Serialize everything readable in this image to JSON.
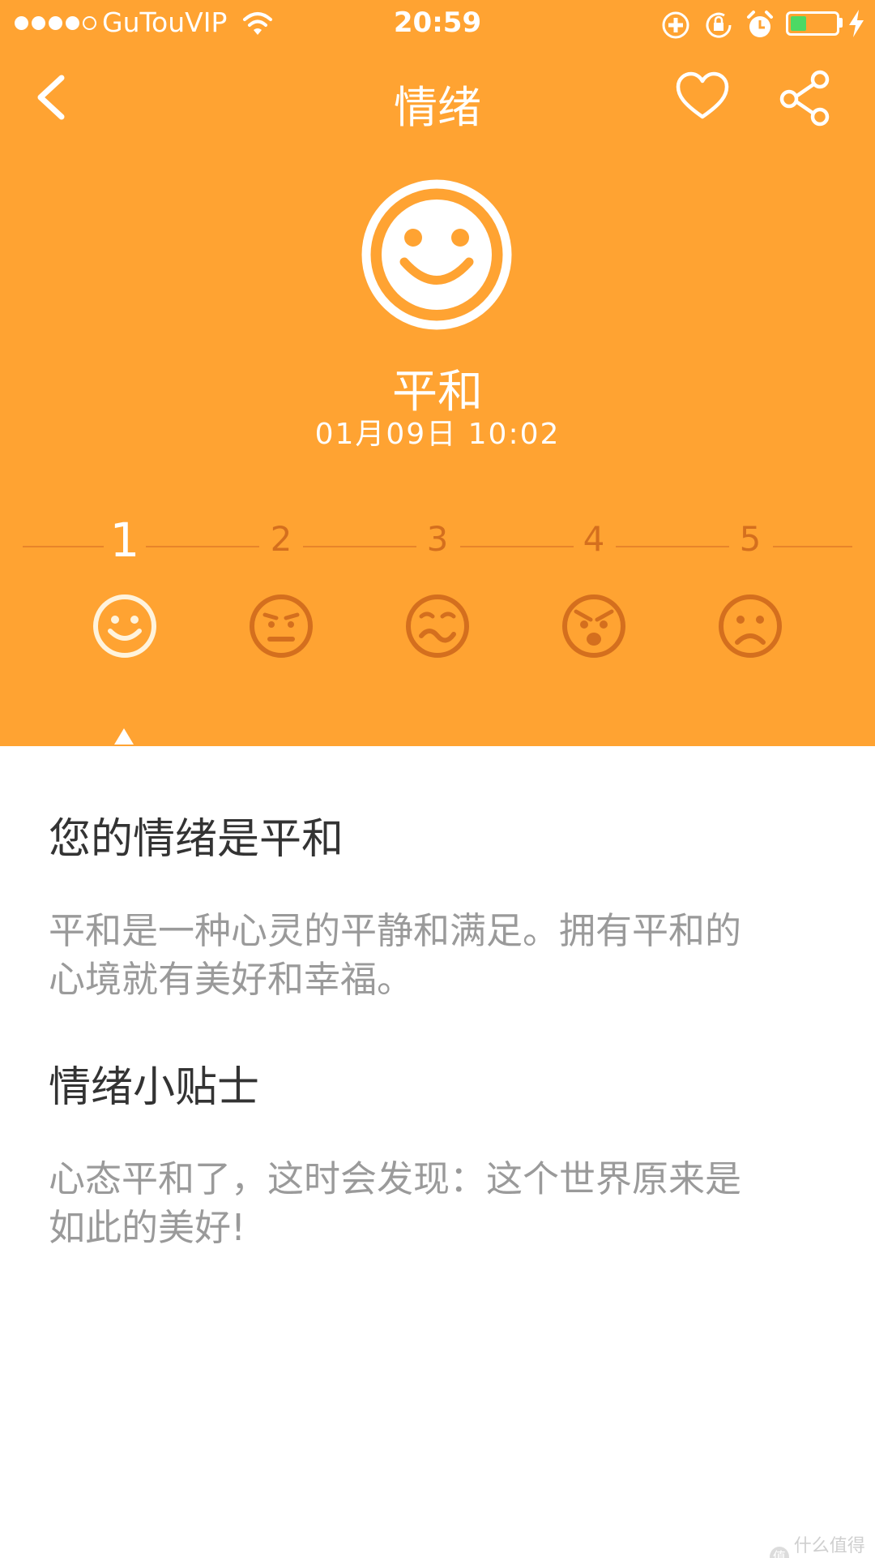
{
  "status_bar": {
    "carrier": "GuTouVIP",
    "time": "20:59",
    "battery_percent": 35,
    "battery_color": "#4cd964",
    "signal_dots": 5,
    "signal_filled": 4
  },
  "nav": {
    "title": "情绪",
    "back_icon": "chevron-left-icon",
    "favorite_icon": "heart-icon",
    "share_icon": "share-icon"
  },
  "colors": {
    "header_bg": "#FFA332",
    "scale_inactive": "#D46F1E",
    "active_white": "#ffffff"
  },
  "mood": {
    "name": "平和",
    "time": "01月09日 10:02",
    "icon": "smile-face-icon"
  },
  "scale": {
    "selected": 1,
    "items": [
      {
        "number": "1",
        "icon": "smile-face-icon"
      },
      {
        "number": "2",
        "icon": "annoyed-face-icon"
      },
      {
        "number": "3",
        "icon": "confused-face-icon"
      },
      {
        "number": "4",
        "icon": "angry-face-icon"
      },
      {
        "number": "5",
        "icon": "sad-face-icon"
      }
    ]
  },
  "content": {
    "heading1": "您的情绪是平和",
    "desc_line1": "平和是一种心灵的平静和满足。拥有平和的",
    "desc_line2": "心境就有美好和幸福。",
    "heading2": "情绪小贴士",
    "tip_line1": "心态平和了，这时会发现：这个世界原来是",
    "tip_line2": "如此的美好!"
  },
  "watermark": {
    "badge": "值",
    "text": "什么值得买"
  }
}
